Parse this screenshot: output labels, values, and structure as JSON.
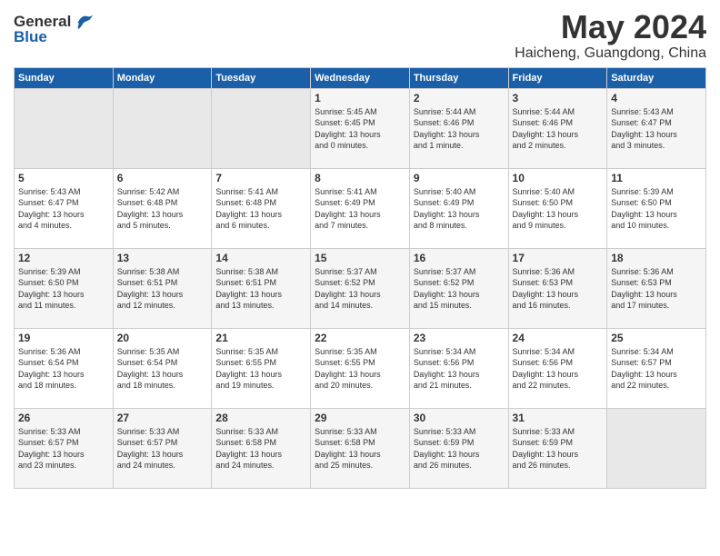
{
  "logo": {
    "general": "General",
    "blue": "Blue"
  },
  "title": "May 2024",
  "location": "Haicheng, Guangdong, China",
  "headers": [
    "Sunday",
    "Monday",
    "Tuesday",
    "Wednesday",
    "Thursday",
    "Friday",
    "Saturday"
  ],
  "weeks": [
    [
      {
        "day": "",
        "info": ""
      },
      {
        "day": "",
        "info": ""
      },
      {
        "day": "",
        "info": ""
      },
      {
        "day": "1",
        "info": "Sunrise: 5:45 AM\nSunset: 6:45 PM\nDaylight: 13 hours\nand 0 minutes."
      },
      {
        "day": "2",
        "info": "Sunrise: 5:44 AM\nSunset: 6:46 PM\nDaylight: 13 hours\nand 1 minute."
      },
      {
        "day": "3",
        "info": "Sunrise: 5:44 AM\nSunset: 6:46 PM\nDaylight: 13 hours\nand 2 minutes."
      },
      {
        "day": "4",
        "info": "Sunrise: 5:43 AM\nSunset: 6:47 PM\nDaylight: 13 hours\nand 3 minutes."
      }
    ],
    [
      {
        "day": "5",
        "info": "Sunrise: 5:43 AM\nSunset: 6:47 PM\nDaylight: 13 hours\nand 4 minutes."
      },
      {
        "day": "6",
        "info": "Sunrise: 5:42 AM\nSunset: 6:48 PM\nDaylight: 13 hours\nand 5 minutes."
      },
      {
        "day": "7",
        "info": "Sunrise: 5:41 AM\nSunset: 6:48 PM\nDaylight: 13 hours\nand 6 minutes."
      },
      {
        "day": "8",
        "info": "Sunrise: 5:41 AM\nSunset: 6:49 PM\nDaylight: 13 hours\nand 7 minutes."
      },
      {
        "day": "9",
        "info": "Sunrise: 5:40 AM\nSunset: 6:49 PM\nDaylight: 13 hours\nand 8 minutes."
      },
      {
        "day": "10",
        "info": "Sunrise: 5:40 AM\nSunset: 6:50 PM\nDaylight: 13 hours\nand 9 minutes."
      },
      {
        "day": "11",
        "info": "Sunrise: 5:39 AM\nSunset: 6:50 PM\nDaylight: 13 hours\nand 10 minutes."
      }
    ],
    [
      {
        "day": "12",
        "info": "Sunrise: 5:39 AM\nSunset: 6:50 PM\nDaylight: 13 hours\nand 11 minutes."
      },
      {
        "day": "13",
        "info": "Sunrise: 5:38 AM\nSunset: 6:51 PM\nDaylight: 13 hours\nand 12 minutes."
      },
      {
        "day": "14",
        "info": "Sunrise: 5:38 AM\nSunset: 6:51 PM\nDaylight: 13 hours\nand 13 minutes."
      },
      {
        "day": "15",
        "info": "Sunrise: 5:37 AM\nSunset: 6:52 PM\nDaylight: 13 hours\nand 14 minutes."
      },
      {
        "day": "16",
        "info": "Sunrise: 5:37 AM\nSunset: 6:52 PM\nDaylight: 13 hours\nand 15 minutes."
      },
      {
        "day": "17",
        "info": "Sunrise: 5:36 AM\nSunset: 6:53 PM\nDaylight: 13 hours\nand 16 minutes."
      },
      {
        "day": "18",
        "info": "Sunrise: 5:36 AM\nSunset: 6:53 PM\nDaylight: 13 hours\nand 17 minutes."
      }
    ],
    [
      {
        "day": "19",
        "info": "Sunrise: 5:36 AM\nSunset: 6:54 PM\nDaylight: 13 hours\nand 18 minutes."
      },
      {
        "day": "20",
        "info": "Sunrise: 5:35 AM\nSunset: 6:54 PM\nDaylight: 13 hours\nand 18 minutes."
      },
      {
        "day": "21",
        "info": "Sunrise: 5:35 AM\nSunset: 6:55 PM\nDaylight: 13 hours\nand 19 minutes."
      },
      {
        "day": "22",
        "info": "Sunrise: 5:35 AM\nSunset: 6:55 PM\nDaylight: 13 hours\nand 20 minutes."
      },
      {
        "day": "23",
        "info": "Sunrise: 5:34 AM\nSunset: 6:56 PM\nDaylight: 13 hours\nand 21 minutes."
      },
      {
        "day": "24",
        "info": "Sunrise: 5:34 AM\nSunset: 6:56 PM\nDaylight: 13 hours\nand 22 minutes."
      },
      {
        "day": "25",
        "info": "Sunrise: 5:34 AM\nSunset: 6:57 PM\nDaylight: 13 hours\nand 22 minutes."
      }
    ],
    [
      {
        "day": "26",
        "info": "Sunrise: 5:33 AM\nSunset: 6:57 PM\nDaylight: 13 hours\nand 23 minutes."
      },
      {
        "day": "27",
        "info": "Sunrise: 5:33 AM\nSunset: 6:57 PM\nDaylight: 13 hours\nand 24 minutes."
      },
      {
        "day": "28",
        "info": "Sunrise: 5:33 AM\nSunset: 6:58 PM\nDaylight: 13 hours\nand 24 minutes."
      },
      {
        "day": "29",
        "info": "Sunrise: 5:33 AM\nSunset: 6:58 PM\nDaylight: 13 hours\nand 25 minutes."
      },
      {
        "day": "30",
        "info": "Sunrise: 5:33 AM\nSunset: 6:59 PM\nDaylight: 13 hours\nand 26 minutes."
      },
      {
        "day": "31",
        "info": "Sunrise: 5:33 AM\nSunset: 6:59 PM\nDaylight: 13 hours\nand 26 minutes."
      },
      {
        "day": "",
        "info": ""
      }
    ]
  ],
  "colors": {
    "header_bg": "#1a5fa8",
    "header_text": "#ffffff",
    "odd_row": "#f5f5f5",
    "even_row": "#ffffff",
    "empty_cell": "#e8e8e8"
  }
}
